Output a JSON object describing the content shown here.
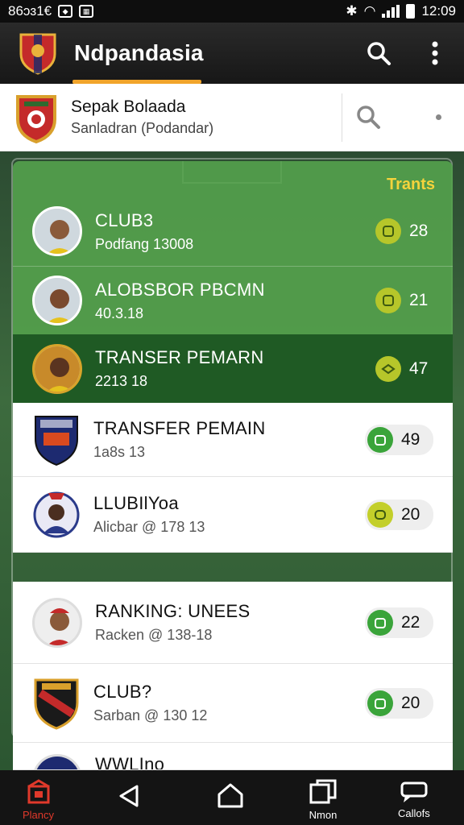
{
  "status_bar": {
    "left_text": "86ɔɜ1€",
    "time": "12:09"
  },
  "app_bar": {
    "title": "Ndpandasia"
  },
  "header_card": {
    "title": "Sepak Bolaada",
    "subtitle": "Sanladran (Podandar)"
  },
  "panel": {
    "title": "Trants"
  },
  "rows": [
    {
      "name": "CLUB3",
      "sub": "Podfang 13008",
      "count": "28"
    },
    {
      "name": "ALOBSBOR PBCMN",
      "sub": "40.3.18",
      "count": "21"
    },
    {
      "name": "TRANSER PEMARN",
      "sub": "2213 18",
      "count": "47"
    },
    {
      "name": "TRANSFER PEMAIN",
      "sub": "1a8s 13",
      "count": "49"
    },
    {
      "name": "LLUBIlYoa",
      "sub": "Alicbar @ 178 13",
      "count": "20"
    },
    {
      "name": "RANKING: UNEES",
      "sub": "Racken @ 138-18",
      "count": "22"
    },
    {
      "name": "CLUB?",
      "sub": "Sarban @ 130 12",
      "count": "20"
    },
    {
      "name": "WWLIno",
      "sub": "",
      "count": ""
    }
  ],
  "bottom_nav": {
    "items": [
      {
        "label": "Plancy",
        "icon": "home-box-icon"
      },
      {
        "label": "",
        "icon": "back-triangle-icon"
      },
      {
        "label": "",
        "icon": "home-icon"
      },
      {
        "label": "Nmon",
        "icon": "recents-icon"
      },
      {
        "label": "Callofs",
        "icon": "chat-icon"
      }
    ]
  },
  "colors": {
    "accent": "#f1a42b",
    "panel_green": "#54a04c",
    "selected_green": "#1f5a24",
    "badge_yellow": "#b6c62a",
    "badge_green": "#3aa43a",
    "title_yellow": "#f4d33c"
  }
}
